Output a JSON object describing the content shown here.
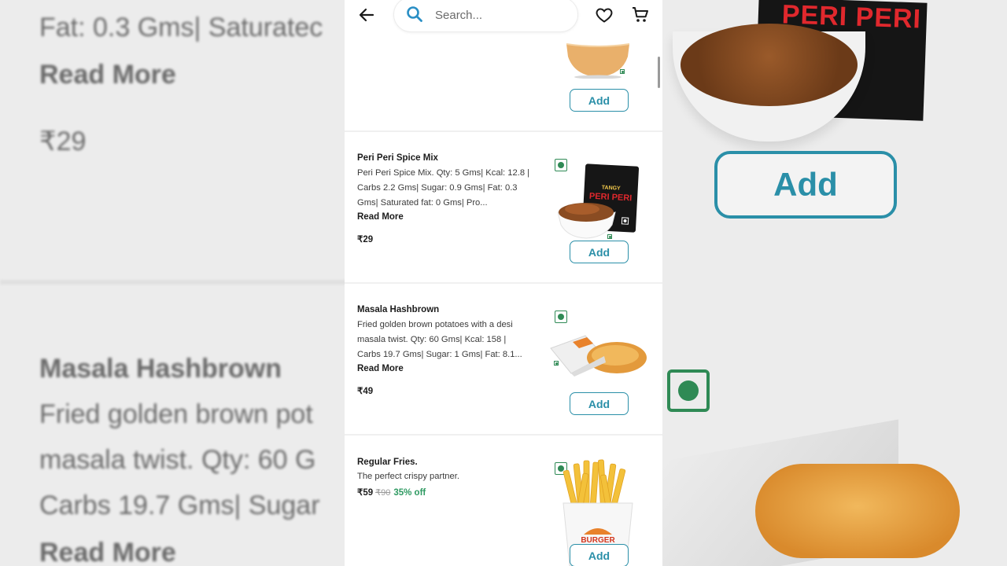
{
  "background": {
    "top_lines": [
      "Fat: 0.3 Gms| Saturatec",
      "Read More",
      "₹29"
    ],
    "bottom_lines": [
      "Masala Hashbrown",
      "Fried golden brown pot",
      "masala twist. Qty: 60 G",
      "Carbs 19.7 Gms| Sugar",
      "Read More"
    ],
    "pack_text": "PERI PERI",
    "add_label": "Add"
  },
  "search": {
    "placeholder": "Search..."
  },
  "icons": {
    "back": "arrow-left-icon",
    "search": "search-icon",
    "wishlist": "heart-icon",
    "cart": "cart-icon",
    "veg": "veg-indicator-icon"
  },
  "colors": {
    "accent": "#2a8fa8",
    "veg": "#2f8a55",
    "discount": "#2f9a62"
  },
  "items": [
    {
      "add_label": "Add"
    },
    {
      "name": "Peri Peri Spice Mix",
      "desc": "Peri Peri Spice Mix. Qty: 5 Gms| Kcal: 12.8 | Carbs 2.2 Gms| Sugar: 0.9 Gms| Fat: 0.3 Gms| Saturated fat: 0 Gms| Pro...",
      "read_more": "Read More",
      "price": "₹29",
      "pack_brand": "TANGY",
      "pack_name": "PERI PERI",
      "add_label": "Add"
    },
    {
      "name": "Masala Hashbrown",
      "desc": "Fried golden brown potatoes with a desi masala twist. Qty: 60 Gms| Kcal: 158 | Carbs 19.7 Gms| Sugar: 1 Gms| Fat: 8.1...",
      "read_more": "Read More",
      "price": "₹49",
      "add_label": "Add"
    },
    {
      "name": "Regular Fries.",
      "desc": "The perfect crispy partner.",
      "price": "₹59",
      "price_old": "₹90",
      "discount": "35% off",
      "cup_brand": "BURGER",
      "add_label": "Add"
    }
  ]
}
